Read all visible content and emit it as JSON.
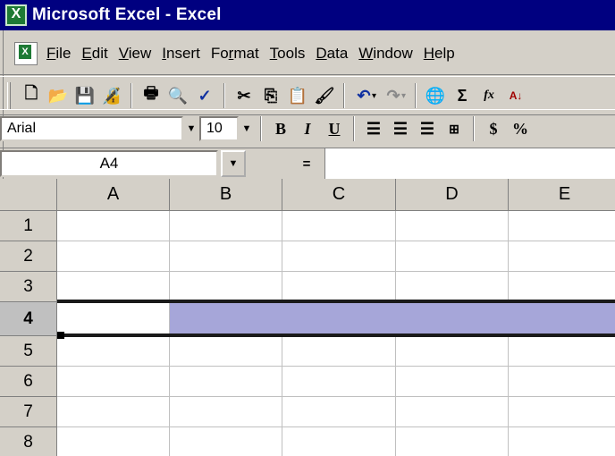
{
  "title": "Microsoft Excel - Excel",
  "menu": [
    "File",
    "Edit",
    "View",
    "Insert",
    "Format",
    "Tools",
    "Data",
    "Window",
    "Help"
  ],
  "menu_underline": [
    "F",
    "E",
    "V",
    "I",
    "r",
    "T",
    "D",
    "W",
    "H"
  ],
  "toolbar_standard": [
    {
      "name": "new-icon",
      "glyph": "🗋"
    },
    {
      "name": "open-icon",
      "glyph": "📂"
    },
    {
      "name": "save-icon",
      "glyph": "💾"
    },
    {
      "name": "permission-icon",
      "glyph": "🔏"
    },
    {
      "name": "print-icon",
      "glyph": "🖶"
    },
    {
      "name": "print-preview-icon",
      "glyph": "🔍"
    },
    {
      "name": "spelling-icon",
      "glyph": "✓"
    },
    {
      "name": "cut-icon",
      "glyph": "✂"
    },
    {
      "name": "copy-icon",
      "glyph": "⎘"
    },
    {
      "name": "paste-icon",
      "glyph": "📋"
    },
    {
      "name": "format-painter-icon",
      "glyph": "🖌"
    },
    {
      "name": "undo-icon",
      "glyph": "↶"
    },
    {
      "name": "redo-icon",
      "glyph": "↷"
    },
    {
      "name": "hyperlink-icon",
      "glyph": "🌐"
    },
    {
      "name": "autosum-icon",
      "glyph": "Σ"
    },
    {
      "name": "function-icon",
      "glyph": "fx"
    },
    {
      "name": "sort-icon",
      "glyph": "A↓"
    }
  ],
  "format_toolbar": {
    "font": "Arial",
    "size": "10",
    "bold": "B",
    "italic": "I",
    "underline": "U",
    "currency": "$",
    "percent": "%"
  },
  "formula_bar": {
    "name_box": "A4",
    "equals": "="
  },
  "columns": [
    "A",
    "B",
    "C",
    "D",
    "E"
  ],
  "rows": [
    "1",
    "2",
    "3",
    "4",
    "5",
    "6",
    "7",
    "8"
  ],
  "active_row": "4",
  "active_cell": "A4",
  "colors": {
    "titlebar": "#000080",
    "selection": "#a6a6d9",
    "chrome": "#d4d0c8"
  }
}
